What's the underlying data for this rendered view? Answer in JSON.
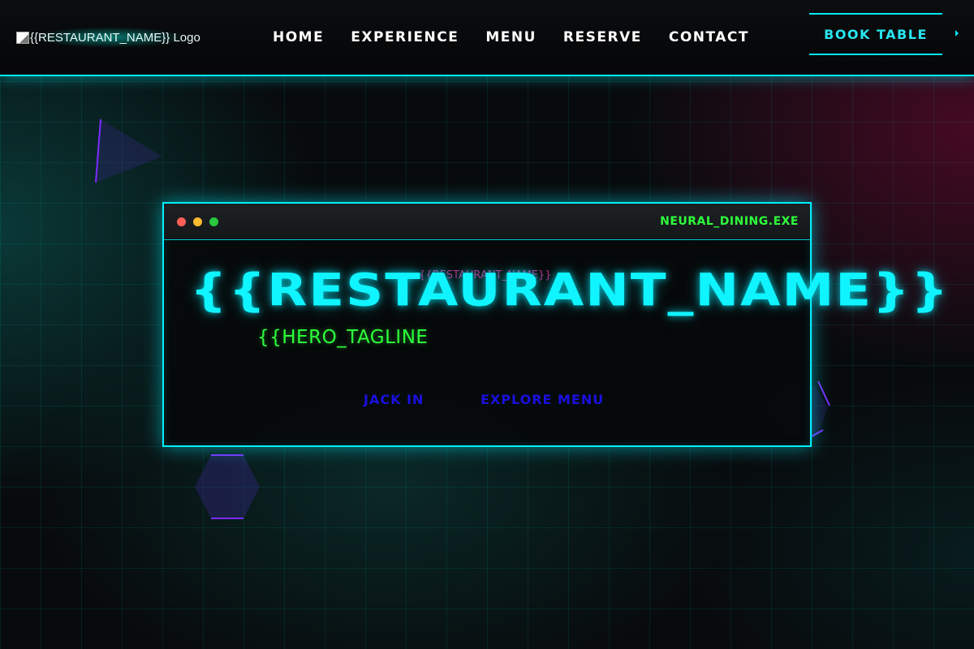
{
  "nav": {
    "logo_alt": "{{RESTAURANT_NAME}} Logo",
    "links": [
      "HOME",
      "EXPERIENCE",
      "MENU",
      "RESERVE",
      "CONTACT"
    ],
    "book_button": "BOOK TABLE"
  },
  "terminal": {
    "title": "NEURAL_DINING.EXE",
    "glitch_text": "{{RESTAURANT_NAME}}",
    "heading": "{{RESTAURANT_NAME}}",
    "tagline": "{{HERO_TAGLINE",
    "buttons": {
      "primary": "JACK IN",
      "secondary": "EXPLORE MENU"
    }
  },
  "colors": {
    "accent_cyan": "#00f0ff",
    "accent_green": "#2dff3a",
    "accent_magenta": "#ff3ab8",
    "cta_blue": "#1a10e0",
    "shape_purple": "#7a2cff"
  },
  "icons": [
    "broken-image-icon",
    "window-close-dot-icon",
    "window-minimize-dot-icon",
    "window-maximize-dot-icon",
    "arrow-right-icon"
  ]
}
